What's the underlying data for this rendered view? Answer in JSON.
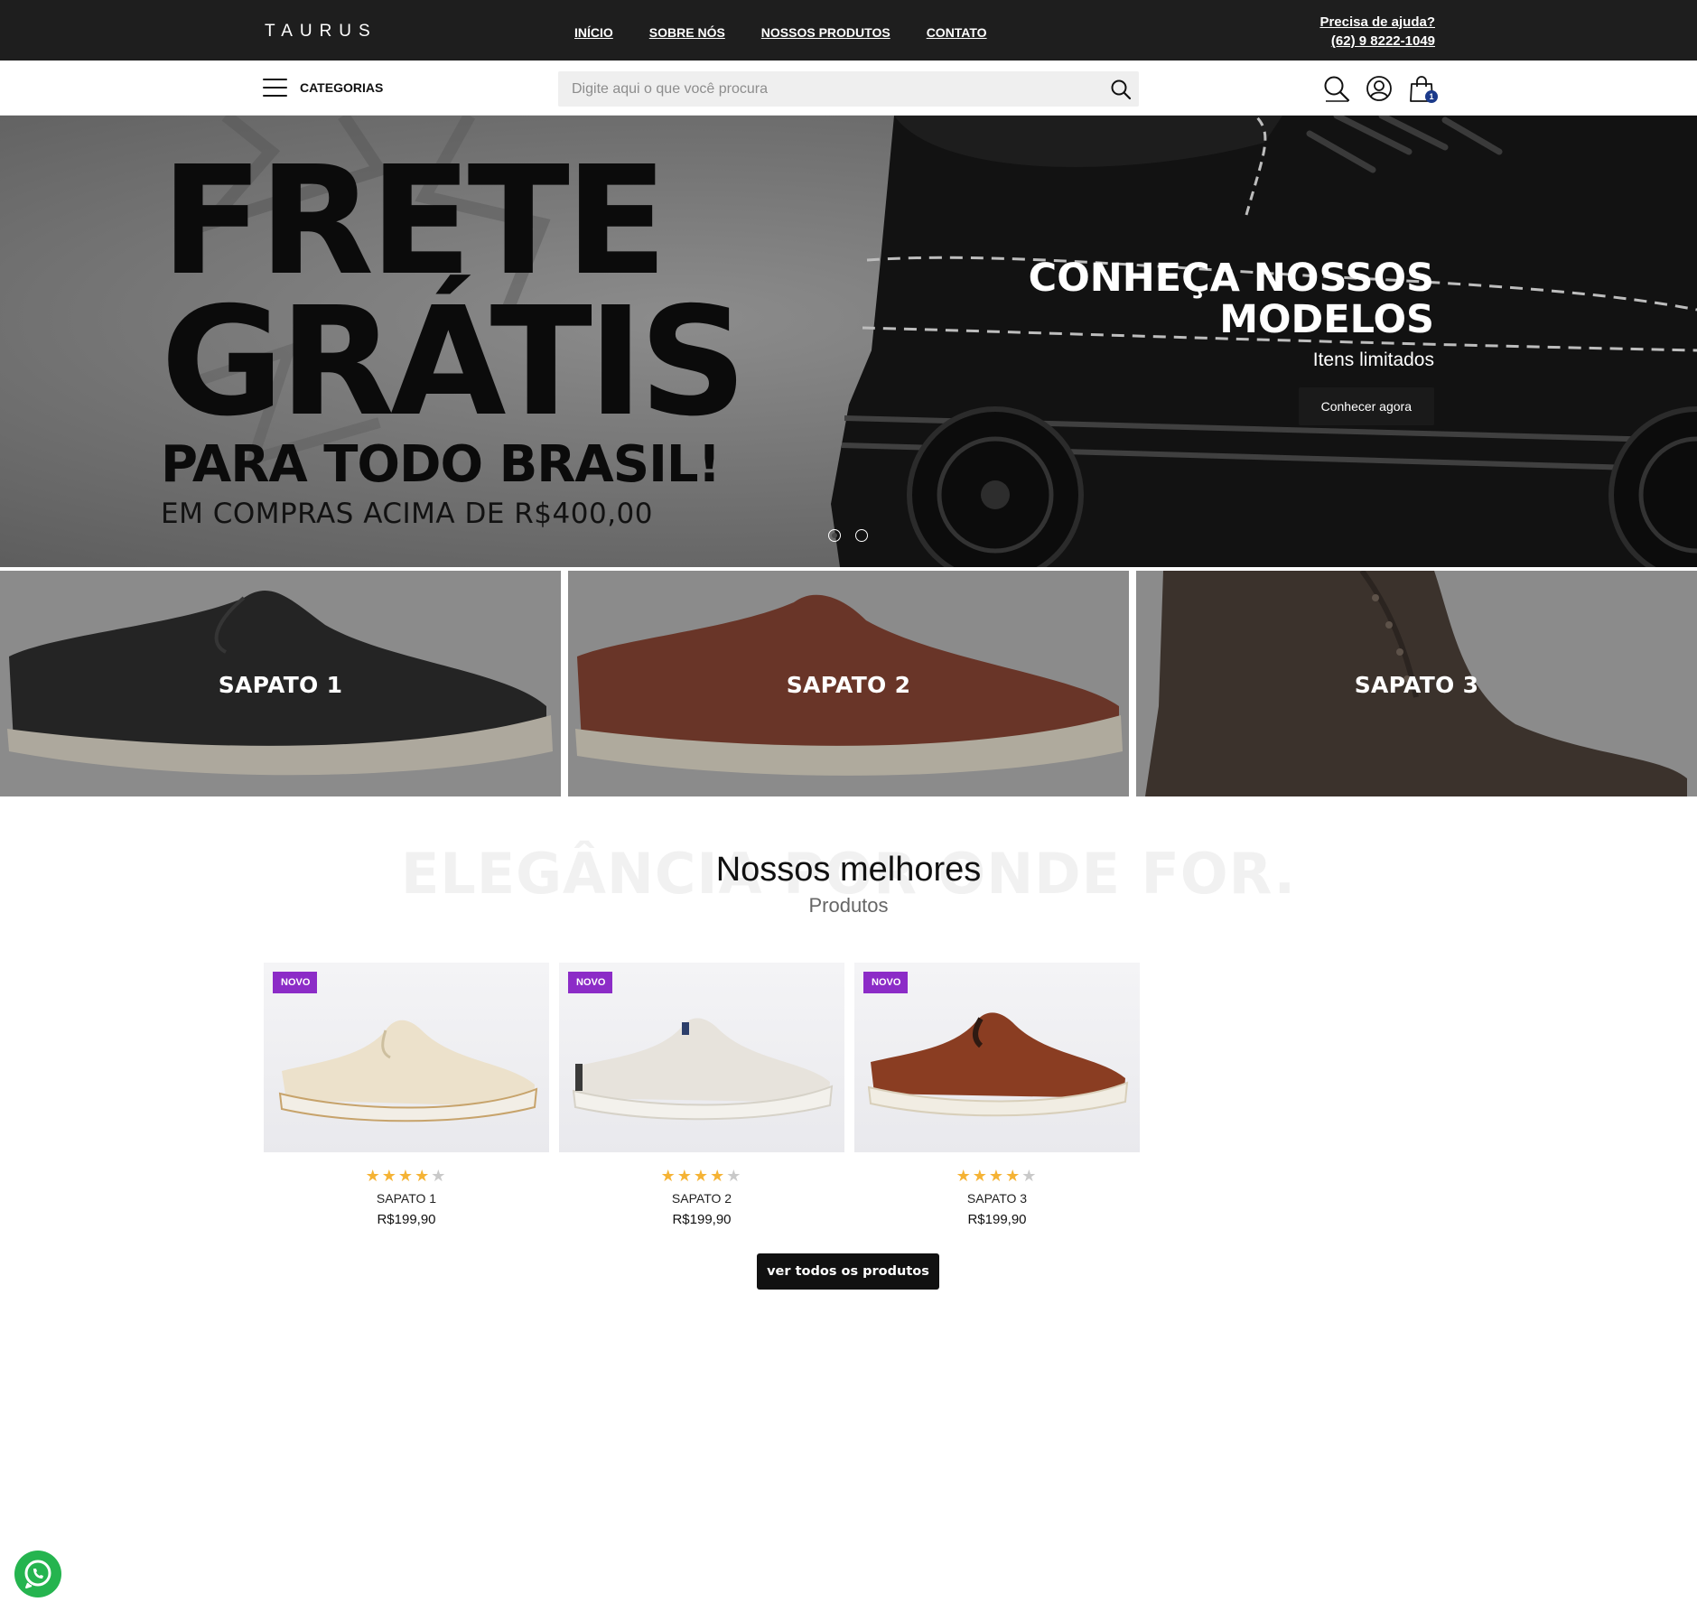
{
  "brand": {
    "logo": "TAURUS"
  },
  "nav": [
    {
      "label": "INÍCIO"
    },
    {
      "label": "SOBRE NÓS"
    },
    {
      "label": "NOSSOS PRODUTOS"
    },
    {
      "label": "CONTATO"
    }
  ],
  "help": {
    "title": "Precisa de ajuda?",
    "phone": "(62) 9 8222-1049"
  },
  "toolbar": {
    "categories_label": "CATEGORIAS",
    "search_placeholder": "Digite aqui o que você procura",
    "cart_count": "1",
    "icons": [
      "menu-icon",
      "search-icon",
      "user-icon",
      "bag-icon"
    ]
  },
  "hero": {
    "banner_line1": "FRETE",
    "banner_line2": "GRÁTIS",
    "banner_line3": "PARA TODO BRASIL!",
    "banner_line4": "EM COMPRAS ACIMA DE R$400,00",
    "title": "CONHEÇA NOSSOS MODELOS",
    "subtitle": "Itens limitados",
    "button": "Conhecer agora",
    "slides": 2,
    "active_slide": 1
  },
  "categories": [
    {
      "label": "SAPATO 1",
      "color": "#1b1b1b"
    },
    {
      "label": "SAPATO 2",
      "color": "#7a3320"
    },
    {
      "label": "SAPATO 3",
      "color": "#3b2e26"
    }
  ],
  "section": {
    "watermark": "ELEGÂNCIA POR ONDE FOR.",
    "title": "Nossos melhores",
    "subtitle": "Produtos"
  },
  "products": [
    {
      "badge": "NOVO",
      "name": "SAPATO 1",
      "price": "R$199,90",
      "rating": 4,
      "rating_max": 5,
      "color": "#efe6d3"
    },
    {
      "badge": "NOVO",
      "name": "SAPATO 2",
      "price": "R$199,90",
      "rating": 4,
      "rating_max": 5,
      "color": "#e7e3dc"
    },
    {
      "badge": "NOVO",
      "name": "SAPATO 3",
      "price": "R$199,90",
      "rating": 4,
      "rating_max": 5,
      "color": "#8a3d22"
    }
  ],
  "cta": {
    "all_products": "ver todos os produtos"
  },
  "colors": {
    "topbar": "#1e1e1e",
    "badge": "#8c2cc7",
    "star": "#f5b335",
    "cart_badge": "#1b3a8a",
    "whatsapp": "#25b44f"
  }
}
